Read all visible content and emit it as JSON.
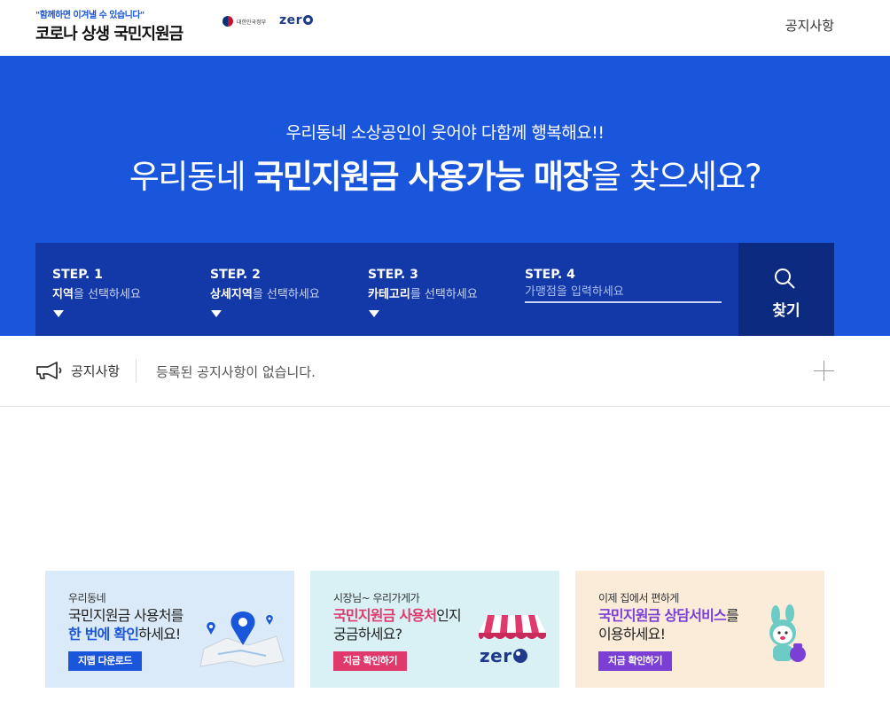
{
  "header": {
    "slogan": "\"함께하면 이겨낼 수 있습니다\"",
    "title": "코로나 상생 국민지원금",
    "gov_label": "대한민국정부",
    "partner_logo": "zer",
    "nav_notice": "공지사항"
  },
  "hero": {
    "subtitle": "우리동네 소상공인이 웃어야 다함께 행복해요!!",
    "title_pre": "우리동네 ",
    "title_bold": "국민지원금 사용가능 매장",
    "title_post": "을 찾으세요?",
    "color": "#1a56db"
  },
  "search": {
    "steps": [
      {
        "label": "STEP. 1",
        "hint_bold": "지역",
        "hint": "을 선택하세요"
      },
      {
        "label": "STEP. 2",
        "hint_bold": "상세지역",
        "hint": "을 선택하세요"
      },
      {
        "label": "STEP. 3",
        "hint_bold": "카테고리",
        "hint": "를 선택하세요"
      },
      {
        "label": "STEP. 4",
        "placeholder": "가맹점을 입력하세요"
      }
    ],
    "find_label": "찾기",
    "find_icon": "search-icon"
  },
  "notice": {
    "icon": "megaphone-icon",
    "title": "공지사항",
    "text": "등록된 공지사항이 없습니다.",
    "expand_icon": "plus-icon"
  },
  "banners": [
    {
      "small": "우리동네",
      "line1": "국민지원금 사용처를",
      "line2_accent": "한 번에 확인",
      "line2": "하세요!",
      "button": "지맵 다운로드",
      "icon": "map-pin-icon"
    },
    {
      "small": "시장님~ 우리가게가",
      "line1_accent": "국민지원금 사용처",
      "line1": "인지",
      "line2": "궁금하세요?",
      "button": "지금 확인하기",
      "icon": "storefront-awning-icon",
      "logo": "zer"
    },
    {
      "small": "이제 집에서 편하게",
      "line1_accent": "국민지원금 상담서비스",
      "line1": "를",
      "line2": "이용하세요!",
      "button": "지금 확인하기",
      "icon": "rabbit-mascot-icon"
    }
  ]
}
